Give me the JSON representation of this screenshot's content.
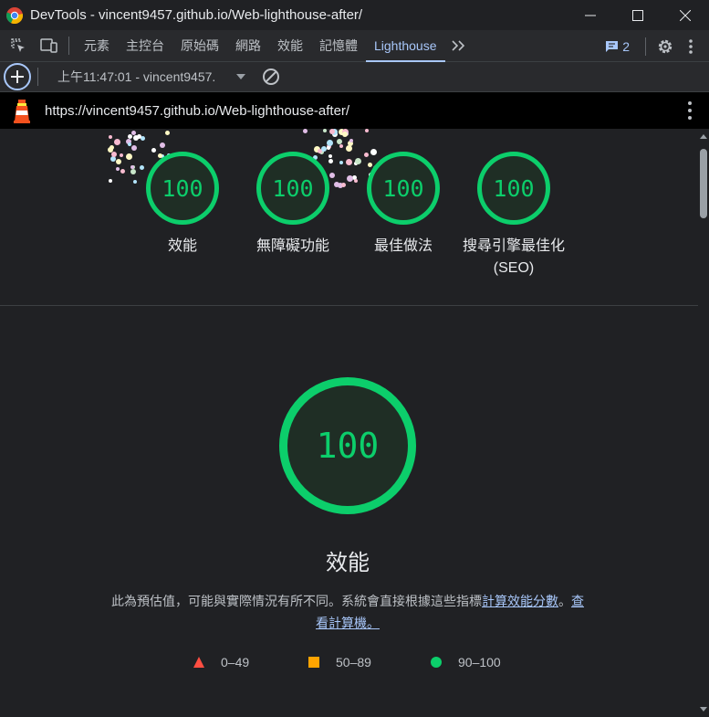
{
  "window": {
    "title": "DevTools - vincent9457.github.io/Web-lighthouse-after/"
  },
  "tabs": [
    {
      "label": "元素"
    },
    {
      "label": "主控台"
    },
    {
      "label": "原始碼"
    },
    {
      "label": "網路"
    },
    {
      "label": "效能"
    },
    {
      "label": "記憶體"
    },
    {
      "label": "Lighthouse",
      "active": true
    }
  ],
  "issues_count": "2",
  "toolbar": {
    "report_selector": "上午11:47:01 - vincent9457."
  },
  "url": "https://vincent9457.github.io/Web-lighthouse-after/",
  "summary_gauges": [
    {
      "score": "100",
      "label": "效能"
    },
    {
      "score": "100",
      "label": "無障礙功能"
    },
    {
      "score": "100",
      "label": "最佳做法"
    },
    {
      "score": "100",
      "label": "搜尋引擎最佳化 (SEO)"
    }
  ],
  "performance": {
    "score": "100",
    "title": "效能",
    "description": "此為預估值，可能與實際情況有所不同。系統會直接根據這些指標",
    "link_calc": "計算效能分數",
    "sep": "。",
    "link_calculator": "查看計算機。"
  },
  "legend": [
    {
      "range": "0–49",
      "shape": "triangle",
      "color": "#ff4e42"
    },
    {
      "range": "50–89",
      "shape": "square",
      "color": "#ffa400"
    },
    {
      "range": "90–100",
      "shape": "circle",
      "color": "#0cce6b"
    }
  ],
  "colors": {
    "pass": "#0cce6b",
    "average": "#ffa400",
    "fail": "#ff4e42",
    "accent": "#a8c7fa"
  }
}
